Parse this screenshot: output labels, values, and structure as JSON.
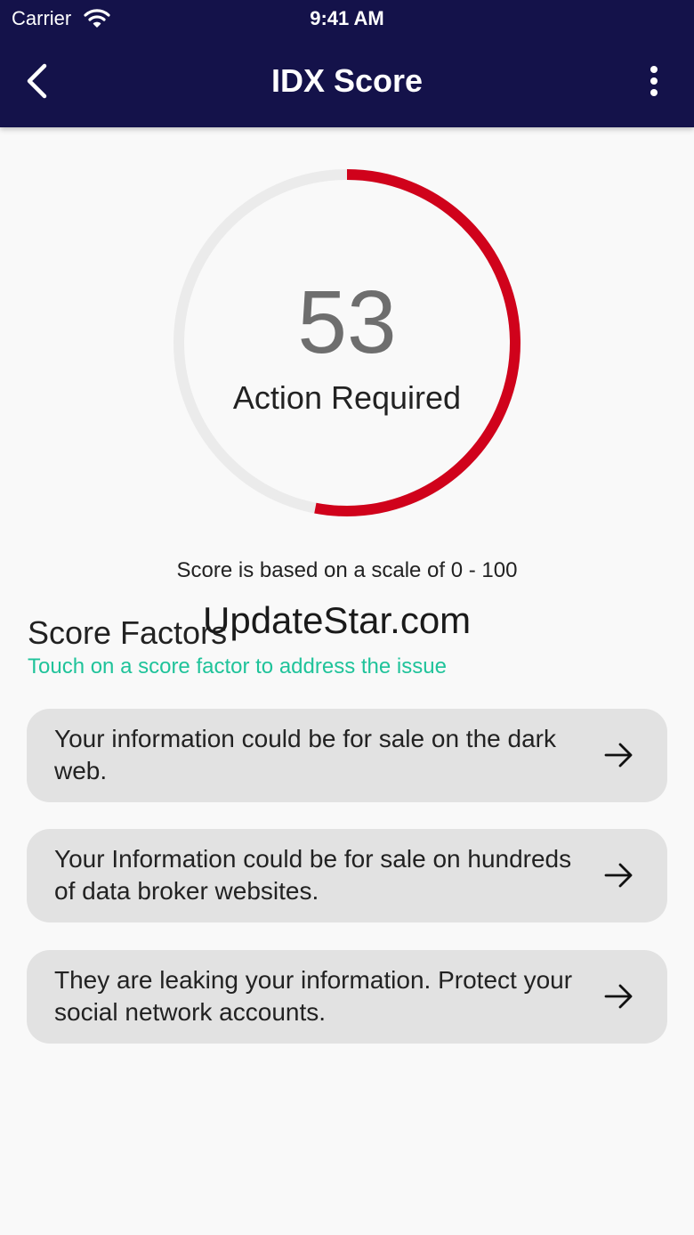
{
  "status_bar": {
    "carrier": "Carrier",
    "time": "9:41 AM"
  },
  "header": {
    "title": "IDX Score",
    "back_icon": "chevron-left-icon",
    "menu_icon": "more-vertical-icon"
  },
  "score": {
    "value": "53",
    "max": 100,
    "fraction": 0.53,
    "status": "Action Required",
    "scale_note": "Score is based on a scale of 0 - 100",
    "progress_color": "#d0021b",
    "track_color": "#ebebeb"
  },
  "watermark": "UpdateStar.com",
  "factors": {
    "title": "Score Factors",
    "subtitle": "Touch on a score factor to address the issue",
    "items": [
      {
        "text": "Your information could be for sale on the dark web."
      },
      {
        "text": "Your Information could be for sale on hundreds of data broker websites."
      },
      {
        "text": "They are leaking your information. Protect your social network accounts."
      }
    ]
  },
  "colors": {
    "header_bg": "#14124a",
    "accent_green": "#1fc39a",
    "card_bg": "#e2e2e2"
  }
}
